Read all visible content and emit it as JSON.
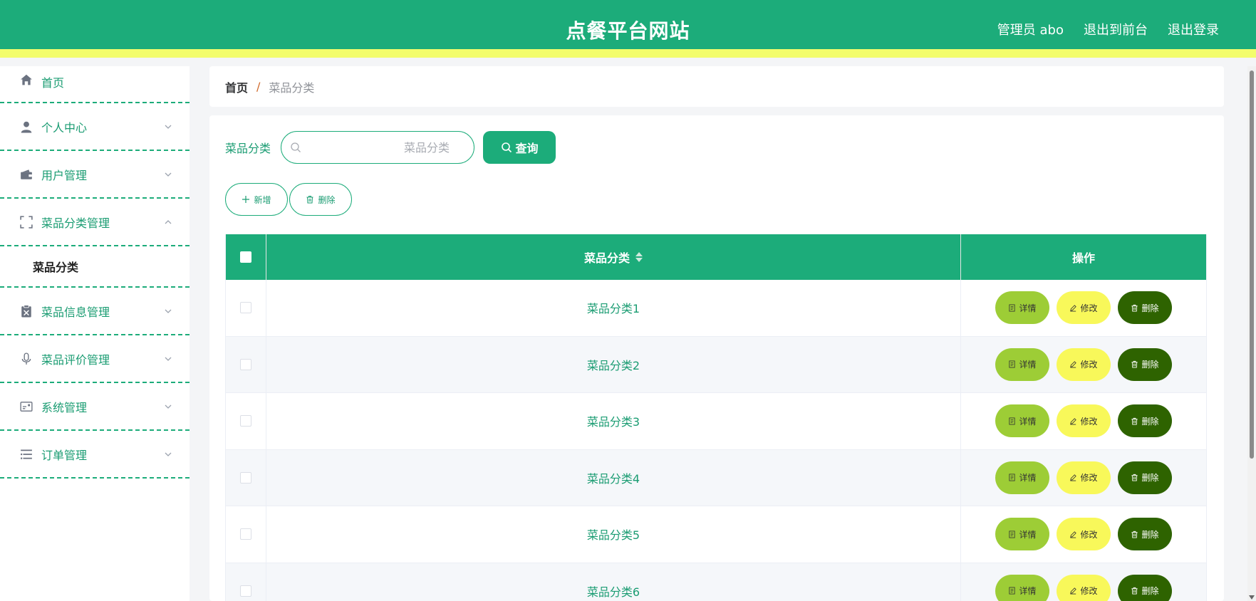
{
  "header": {
    "title": "点餐平台网站",
    "user": "管理员 abo",
    "to_front": "退出到前台",
    "logout": "退出登录"
  },
  "sidebar": {
    "items": [
      {
        "label": "首页",
        "icon": "home-icon"
      },
      {
        "label": "个人中心",
        "icon": "user-icon"
      },
      {
        "label": "用户管理",
        "icon": "wallet-icon"
      },
      {
        "label": "菜品分类管理",
        "icon": "scan-icon",
        "expanded": true,
        "children": [
          "菜品分类"
        ]
      },
      {
        "label": "菜品信息管理",
        "icon": "clipboard-icon"
      },
      {
        "label": "菜品评价管理",
        "icon": "microphone-icon"
      },
      {
        "label": "系统管理",
        "icon": "card-icon"
      },
      {
        "label": "订单管理",
        "icon": "list-icon"
      }
    ]
  },
  "breadcrumb": {
    "home": "首页",
    "separator": "/",
    "current": "菜品分类"
  },
  "search": {
    "label": "菜品分类",
    "placeholder": "菜品分类",
    "query_label": "查询"
  },
  "actions": {
    "add_label": "新增",
    "delete_label": "删除"
  },
  "table": {
    "columns": [
      "菜品分类",
      "操作"
    ],
    "rows": [
      "菜品分类1",
      "菜品分类2",
      "菜品分类3",
      "菜品分类4",
      "菜品分类5",
      "菜品分类6"
    ],
    "op_labels": {
      "detail": "详情",
      "edit": "修改",
      "delete": "删除"
    }
  },
  "colors": {
    "primary": "#1cac7a",
    "accent_strip": "#f3fd6c",
    "detail_btn": "#9dcd36",
    "edit_btn": "#f8f85a",
    "delete_btn": "#2e6300"
  }
}
